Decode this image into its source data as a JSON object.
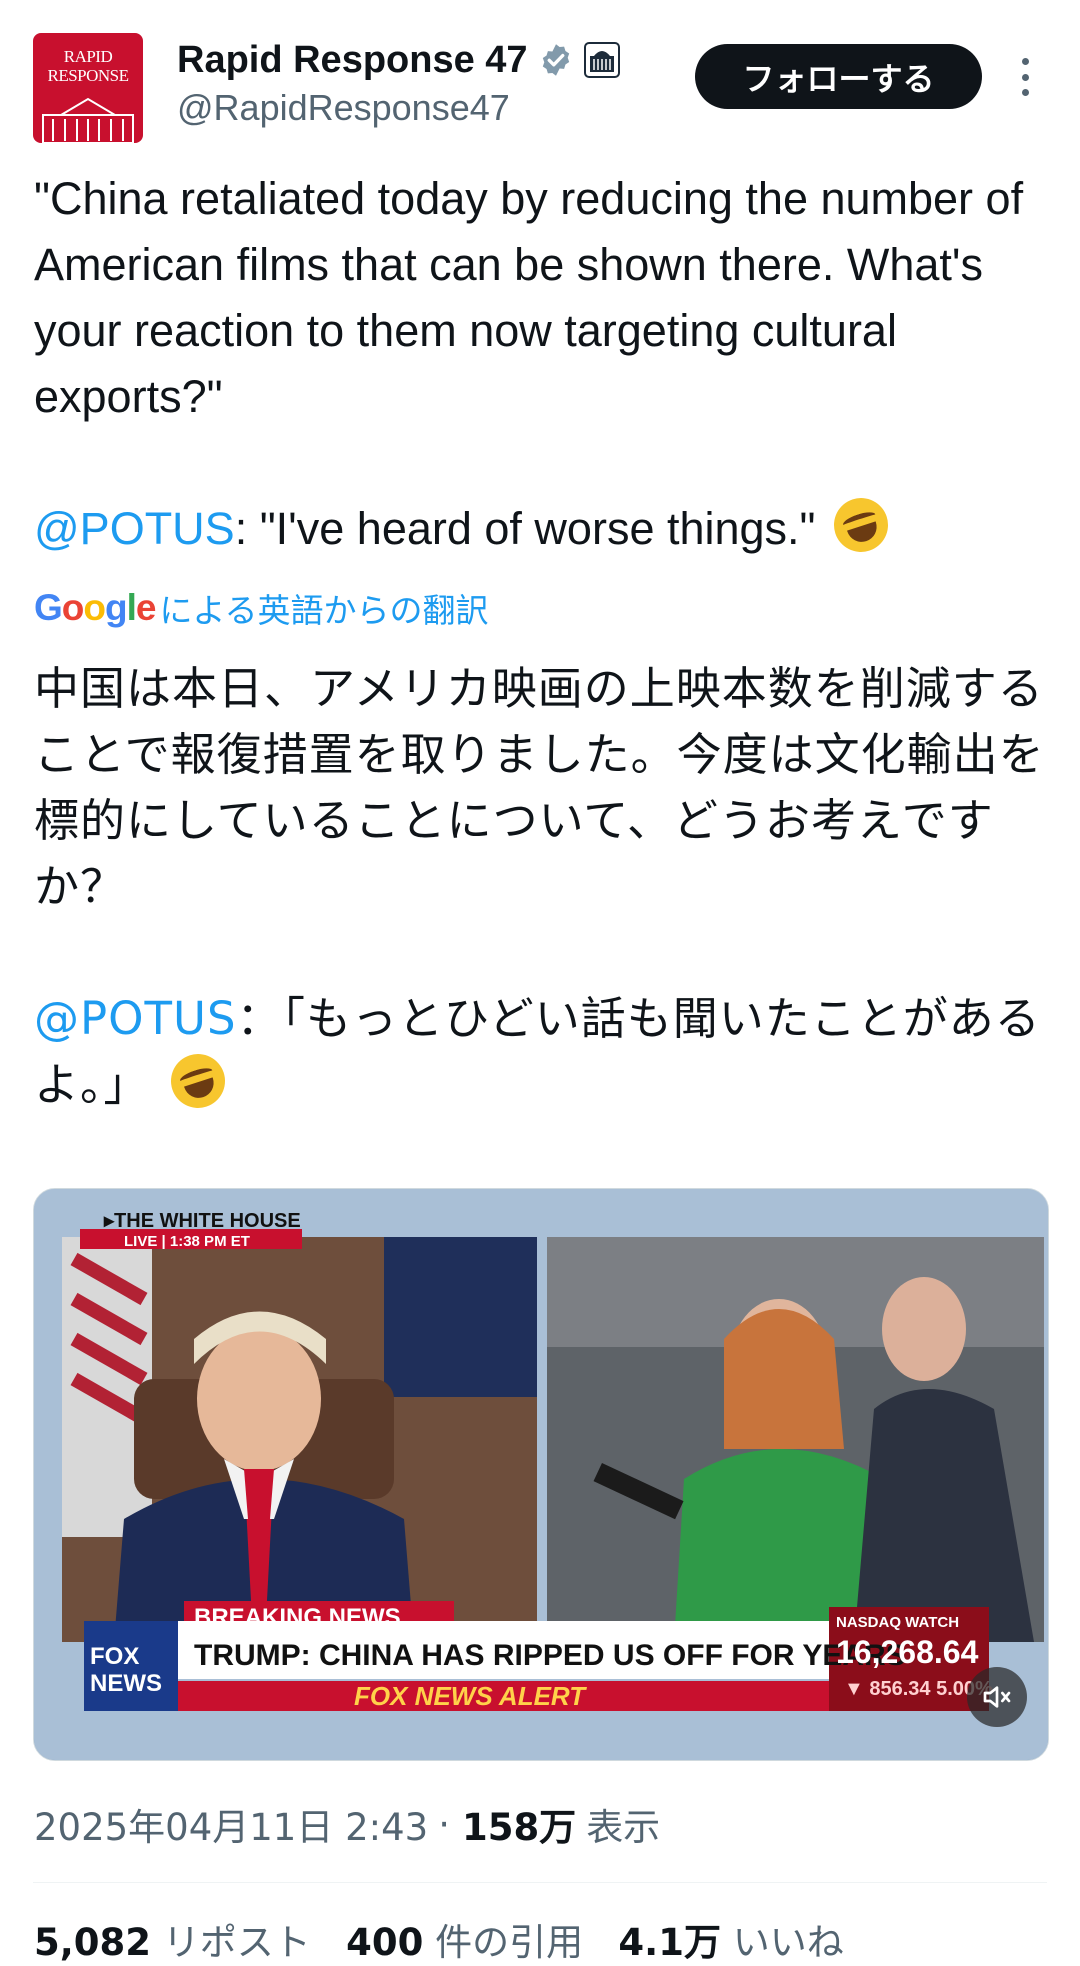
{
  "author": {
    "display_name": "Rapid Response 47",
    "handle": "@RapidResponse47",
    "avatar_text": "RAPID\nRESPONSE",
    "verified_icon": "verified-badge-icon",
    "affiliation_icon": "white-house-icon"
  },
  "follow_button": {
    "label": "フォローする"
  },
  "tweet": {
    "text_en_quote": "\"China retaliated today by reducing the number of American films that can be shown there. What's your reaction to them now targeting cultural exports?\"",
    "mention": "@POTUS",
    "text_en_reply": ": \"I've heard of worse things.\"",
    "translate_label": "による英語からの翻訳",
    "google_logo": [
      "G",
      "o",
      "o",
      "g",
      "l",
      "e"
    ],
    "text_ja_quote": "中国は本日、アメリカ映画の上映本数を削減することで報復措置を取りました。今度は文化輸出を標的にしていることについて、どうお考えですか？",
    "text_ja_reply": "：「もっとひどい話も聞いたことがあるよ。」",
    "emoji": "rolling-on-floor-laughing-emoji"
  },
  "media": {
    "video_description_icon": "video-thumbnail",
    "mute_icon": "muted-speaker-icon"
  },
  "meta": {
    "timestamp": "2025年04月11日 2:43",
    "separator": "·",
    "views": "158万",
    "views_label": "表示"
  },
  "stats": {
    "reposts_count": "5,082",
    "reposts_label": "リポスト",
    "quotes_count": "400",
    "quotes_label": "件の引用",
    "likes_count": "4.1万",
    "likes_label": "いいね"
  },
  "colors": {
    "accent": "#1d9bf0",
    "text": "#0f1419",
    "secondary": "#536471",
    "avatar_bg": "#c8102e"
  }
}
